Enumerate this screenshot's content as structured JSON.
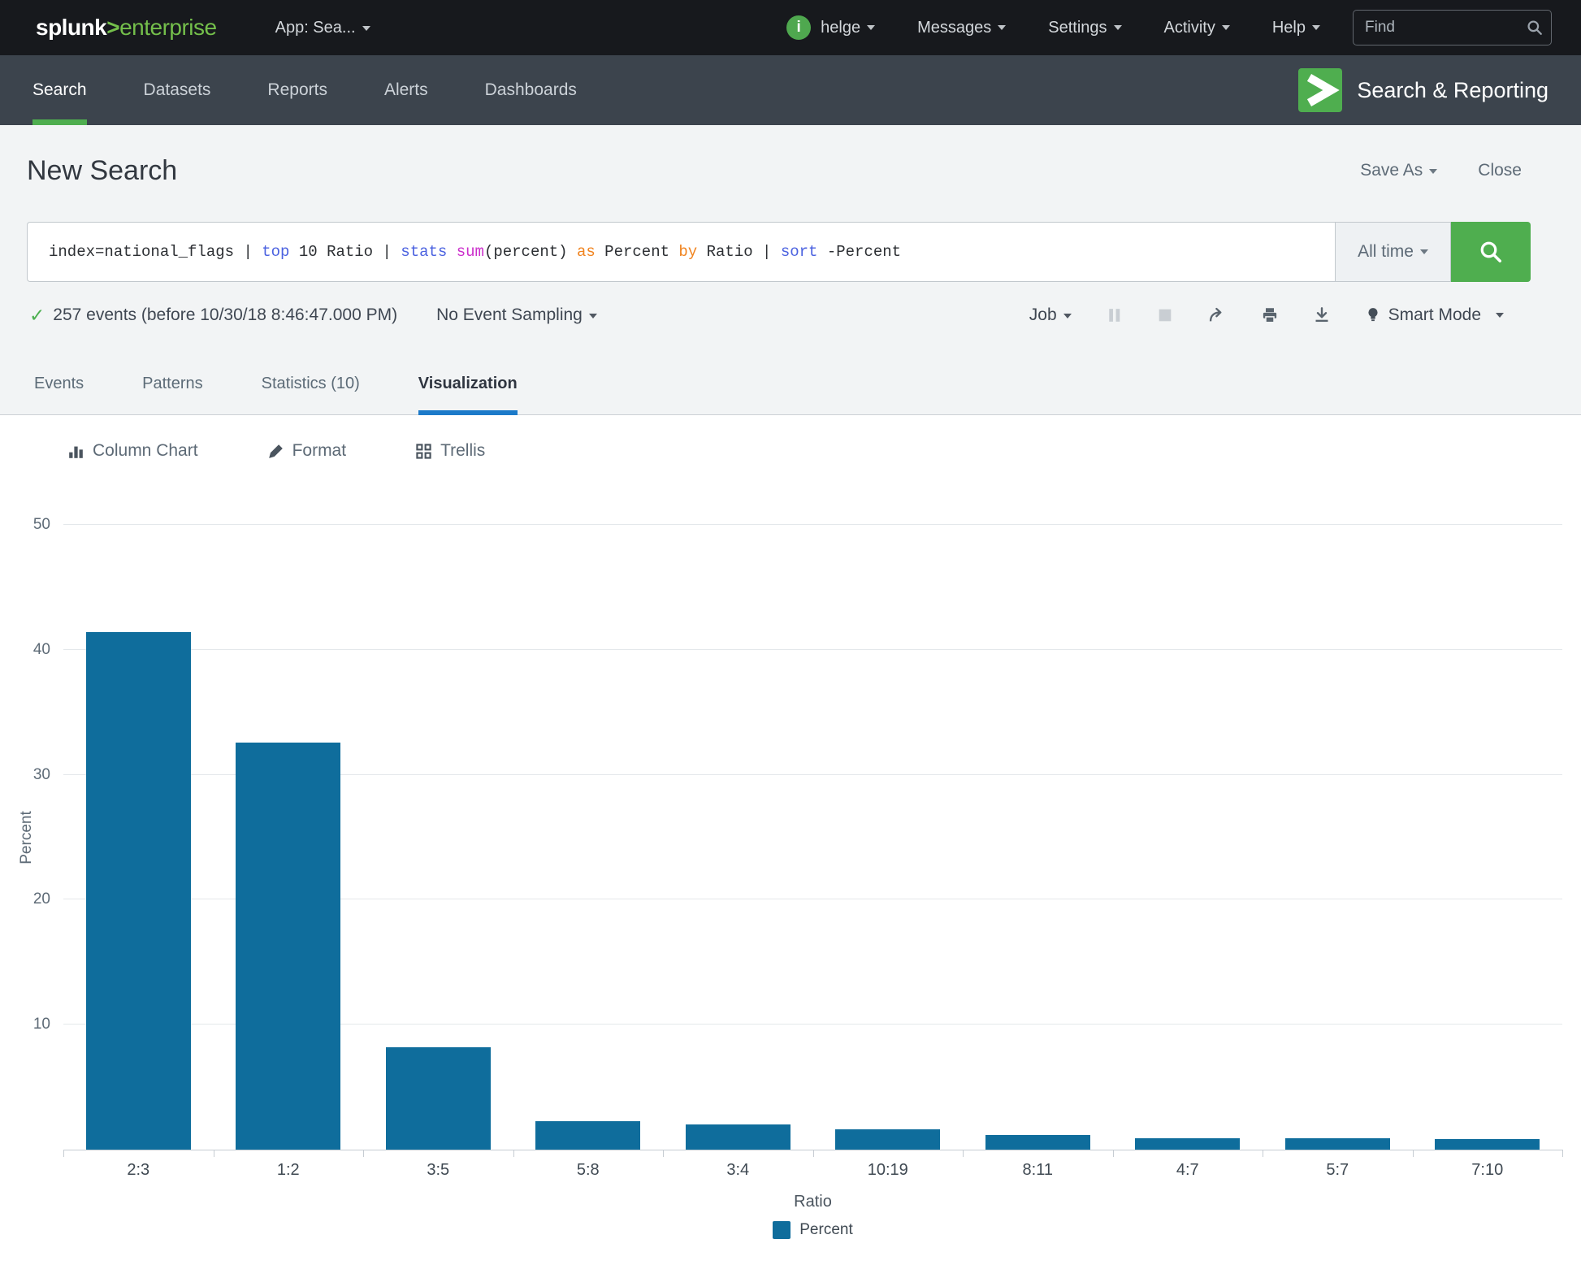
{
  "topbar": {
    "logo": {
      "brand": "splunk",
      "gt": ">",
      "product": "enterprise"
    },
    "app_menu_label": "App: Sea...",
    "menus": [
      {
        "label": "helge",
        "icon": "info"
      },
      {
        "label": "Messages"
      },
      {
        "label": "Settings"
      },
      {
        "label": "Activity"
      },
      {
        "label": "Help"
      }
    ],
    "find_placeholder": "Find"
  },
  "appbar": {
    "tabs": [
      {
        "label": "Search",
        "active": true
      },
      {
        "label": "Datasets",
        "active": false
      },
      {
        "label": "Reports",
        "active": false
      },
      {
        "label": "Alerts",
        "active": false
      },
      {
        "label": "Dashboards",
        "active": false
      }
    ],
    "app_name": "Search & Reporting"
  },
  "page": {
    "title": "New Search",
    "save_as_label": "Save As",
    "close_label": "Close"
  },
  "searchbar": {
    "query_tokens": [
      {
        "text": "index=national_flags | ",
        "type": "plain"
      },
      {
        "text": "top",
        "type": "command"
      },
      {
        "text": " 10 Ratio | ",
        "type": "plain"
      },
      {
        "text": "stats",
        "type": "command"
      },
      {
        "text": " ",
        "type": "plain"
      },
      {
        "text": "sum",
        "type": "function"
      },
      {
        "text": "(percent) ",
        "type": "plain"
      },
      {
        "text": "as",
        "type": "keyword"
      },
      {
        "text": " Percent ",
        "type": "plain"
      },
      {
        "text": "by",
        "type": "keyword"
      },
      {
        "text": " Ratio | ",
        "type": "plain"
      },
      {
        "text": "sort",
        "type": "command"
      },
      {
        "text": " -Percent",
        "type": "plain"
      }
    ],
    "time_range_label": "All time"
  },
  "statusbar": {
    "events_text": "257 events (before 10/30/18 8:46:47.000 PM)",
    "sampling_label": "No Event Sampling",
    "job_label": "Job",
    "mode_label": "Smart Mode"
  },
  "result_tabs": [
    {
      "label": "Events",
      "active": false
    },
    {
      "label": "Patterns",
      "active": false
    },
    {
      "label": "Statistics (10)",
      "active": false
    },
    {
      "label": "Visualization",
      "active": true
    }
  ],
  "viz_toolbar": {
    "chart_type_label": "Column Chart",
    "format_label": "Format",
    "trellis_label": "Trellis"
  },
  "chart_data": {
    "type": "bar",
    "title": "",
    "categories": [
      "2:3",
      "1:2",
      "3:5",
      "5:8",
      "3:4",
      "10:19",
      "8:11",
      "4:7",
      "5:7",
      "7:10"
    ],
    "values": [
      41.4,
      32.6,
      8.2,
      2.3,
      2.0,
      1.6,
      1.2,
      0.9,
      0.9,
      0.85
    ],
    "series_name": "Percent",
    "xlabel": "Ratio",
    "ylabel": "Percent",
    "ylim": [
      0,
      50
    ],
    "yticks": [
      10,
      20,
      30,
      40,
      50
    ],
    "grid": true,
    "legend": [
      "Percent"
    ],
    "legend_position": "bottom",
    "bar_color": "#0f6d9c"
  },
  "icons": {
    "find": "magnifier-icon",
    "search_submit": "magnifier-icon",
    "user_badge": "info-icon",
    "events_status": "check-icon",
    "job_pause": "pause-icon",
    "job_stop": "stop-icon",
    "share": "share-icon",
    "print": "print-icon",
    "export": "download-icon",
    "smart_mode": "lightbulb-icon",
    "chart_type": "column-chart-icon",
    "format": "paintbrush-icon",
    "trellis": "grid-icon",
    "app_logo": "chevron-right-icon"
  },
  "colors": {
    "topbar_bg": "#17191d",
    "appbar_bg": "#3c444d",
    "accent_green": "#4fae4f",
    "logo_green": "#74bf4b",
    "bar_blue": "#0f6d9c",
    "tab_underline_blue": "#1c7ac9",
    "page_bg": "#f2f4f5"
  }
}
